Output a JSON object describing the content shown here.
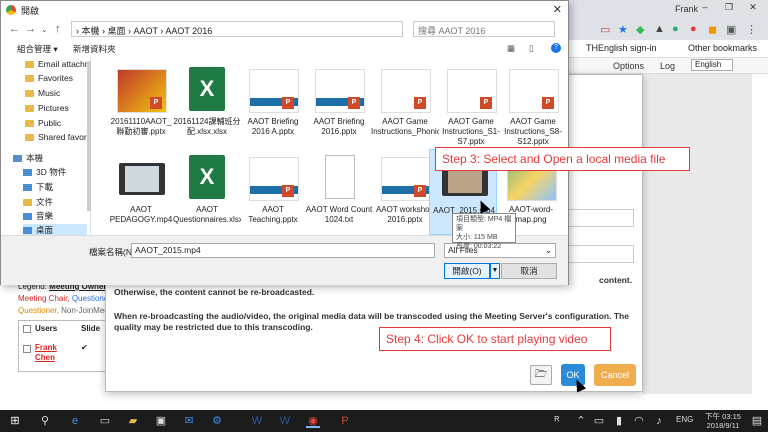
{
  "browser": {
    "profile": "Frank",
    "bookmarks": [
      "THEnglish sign-in",
      "Other bookmarks"
    ]
  },
  "page": {
    "nav": [
      "Options",
      "Log"
    ],
    "language": "English",
    "legend_label": "Legend:",
    "legend_items": [
      "Meeting Owner",
      "Meeting Chair,",
      "Questioner",
      "Questioner,",
      "Non-JoinMeeting"
    ],
    "table_headers": [
      "Users",
      "Slide"
    ],
    "user_name": "Frank Chen",
    "check_mark": "✔"
  },
  "meeting_dialog": {
    "msg_tail": "content.",
    "msg1": "Otherwise, the content cannot be re-broadcasted.",
    "msg2": "When re-broadcasting the audio/video, the original media data will be transcoded using the Meeting Server's configuration. The quality may be restricted due to this transcoding.",
    "step4": "Step 4: Click OK to start playing video",
    "ok": "OK",
    "cancel": "Cancel"
  },
  "file_dialog": {
    "title": "開啟",
    "path": "›  本機  ›  桌面  ›  AAOT  ›  AAOT 2016",
    "search_placeholder": "搜尋 AAOT 2016",
    "organize": "組合管理 ▾",
    "new_folder": "新增資料夾",
    "sidebar": [
      {
        "label": "Email attachme",
        "icon": "folder-icon"
      },
      {
        "label": "Favorites",
        "icon": "folder-icon"
      },
      {
        "label": "Music",
        "icon": "folder-icon"
      },
      {
        "label": "Pictures",
        "icon": "folder-icon"
      },
      {
        "label": "Public",
        "icon": "folder-icon"
      },
      {
        "label": "Shared favorite",
        "icon": "folder-icon"
      },
      {
        "label": "本機",
        "icon": "computer-icon"
      },
      {
        "label": "3D 物件",
        "icon": "cube-icon"
      },
      {
        "label": "下載",
        "icon": "download-icon"
      },
      {
        "label": "文件",
        "icon": "document-icon"
      },
      {
        "label": "音樂",
        "icon": "music-icon"
      },
      {
        "label": "桌面",
        "icon": "desktop-icon"
      }
    ],
    "files": [
      {
        "label": "20161110AAOT_聯勤初審.pptx",
        "type": "pptx"
      },
      {
        "label": "20161124課輔班分配.xlsx.xlsx",
        "type": "xlsx"
      },
      {
        "label": "AAOT Briefing 2016 A.pptx",
        "type": "pptx"
      },
      {
        "label": "AAOT Briefing 2016.pptx",
        "type": "pptx"
      },
      {
        "label": "AAOT Game Instructions_Phonics.pptx",
        "type": "pptx"
      },
      {
        "label": "AAOT Game Instructions_S1-S7.pptx",
        "type": "pptx"
      },
      {
        "label": "AAOT Game Instructions_S8-S12.pptx",
        "type": "pptx"
      },
      {
        "label": "AAOT PEDAGOGY.mp4",
        "type": "mp4"
      },
      {
        "label": "AAOT Questionnaires.xlsx",
        "type": "xlsx"
      },
      {
        "label": "AAOT Teaching.pptx",
        "type": "pptx"
      },
      {
        "label": "AAOT Word Count 1024.txt",
        "type": "txt"
      },
      {
        "label": "AAOT workshop 2016.pptx",
        "type": "pptx"
      },
      {
        "label": "AAOT_2015.mp4",
        "type": "mp4"
      },
      {
        "label": "AAOT-word-map.png",
        "type": "png"
      }
    ],
    "step3": "Step 3: Select and Open a local media file",
    "tooltip": [
      "項目類型: MP4 檔案",
      "大小: 115 MB",
      "長度: 00:03:22"
    ],
    "filename_label": "檔案名稱(N):",
    "filename_value": "AAOT_2015.mp4",
    "filter": "All Files",
    "open": "開啟(O)",
    "cancel": "取消"
  },
  "taskbar": {
    "lang": "ENG",
    "time": "下午 03:15",
    "date": "2018/9/11"
  }
}
